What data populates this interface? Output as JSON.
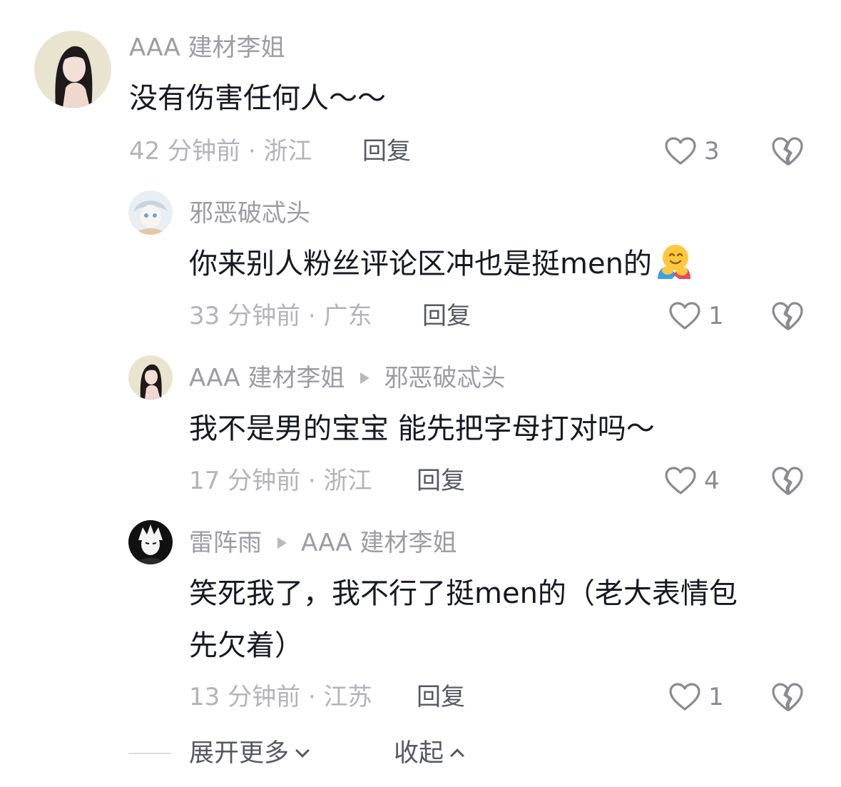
{
  "comments": [
    {
      "avatar": "girl-avatar",
      "username": "AAA 建材李姐",
      "reply_to": "",
      "text": "没有伤害任何人～～",
      "time_location": "42 分钟前 · 浙江",
      "reply_label": "回复",
      "likes": "3"
    },
    {
      "avatar": "anime-avatar",
      "username": "邪恶破忒头",
      "reply_to": "",
      "text": "你来别人粉丝评论区冲也是挺men的",
      "emoji": "hugging-face-emoji",
      "time_location": "33 分钟前 · 广东",
      "reply_label": "回复",
      "likes": "1"
    },
    {
      "avatar": "girl-avatar",
      "username": "AAA 建材李姐",
      "reply_to": "邪恶破忒头",
      "text": "我不是男的宝宝 能先把字母打对吗～",
      "time_location": "17 分钟前 · 浙江",
      "reply_label": "回复",
      "likes": "4"
    },
    {
      "avatar": "manga-avatar",
      "username": "雷阵雨",
      "reply_to": "AAA 建材李姐",
      "text_line1": "笑死我了，我不行了挺men的（老大表情包",
      "text_line2": "先欠着）",
      "time_location": "13 分钟前 · 江苏",
      "reply_label": "回复",
      "likes": "1"
    }
  ],
  "footer": {
    "expand_label": "展开更多",
    "collapse_label": "收起"
  },
  "colors": {
    "username": "#9c9ca2",
    "text": "#161823",
    "meta": "#b3b3b8",
    "icon": "#8a8a90"
  }
}
